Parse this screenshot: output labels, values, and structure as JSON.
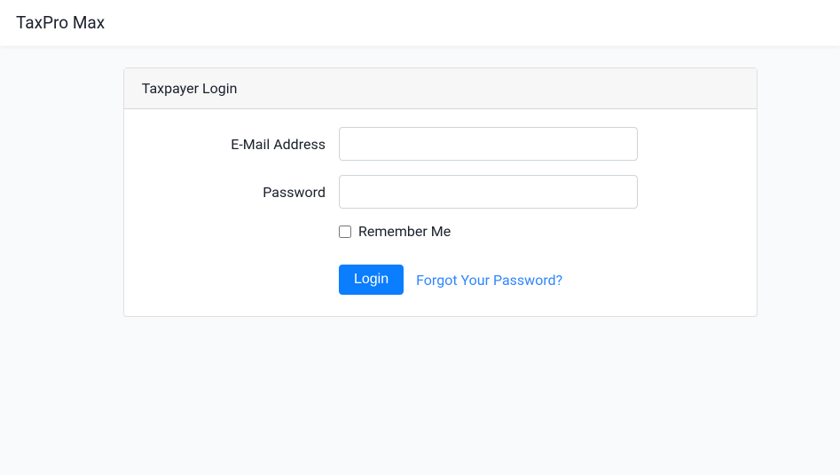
{
  "navbar": {
    "brand": "TaxPro Max"
  },
  "card": {
    "header": "Taxpayer Login",
    "form": {
      "email_label": "E-Mail Address",
      "email_value": "",
      "password_label": "Password",
      "password_value": "",
      "remember_label": "Remember Me",
      "login_button": "Login",
      "forgot_link": "Forgot Your Password?"
    }
  }
}
